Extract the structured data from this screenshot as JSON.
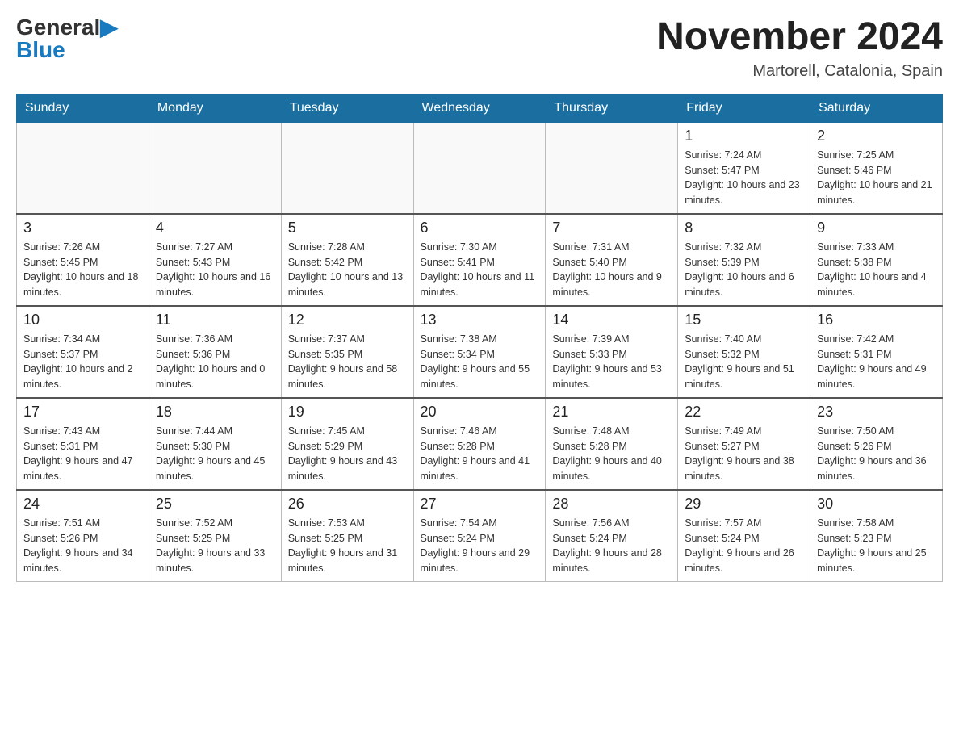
{
  "header": {
    "logo_general": "General",
    "logo_blue": "Blue",
    "month_year": "November 2024",
    "location": "Martorell, Catalonia, Spain"
  },
  "days_of_week": [
    "Sunday",
    "Monday",
    "Tuesday",
    "Wednesday",
    "Thursday",
    "Friday",
    "Saturday"
  ],
  "weeks": [
    [
      {
        "day": "",
        "info": ""
      },
      {
        "day": "",
        "info": ""
      },
      {
        "day": "",
        "info": ""
      },
      {
        "day": "",
        "info": ""
      },
      {
        "day": "",
        "info": ""
      },
      {
        "day": "1",
        "info": "Sunrise: 7:24 AM\nSunset: 5:47 PM\nDaylight: 10 hours and 23 minutes."
      },
      {
        "day": "2",
        "info": "Sunrise: 7:25 AM\nSunset: 5:46 PM\nDaylight: 10 hours and 21 minutes."
      }
    ],
    [
      {
        "day": "3",
        "info": "Sunrise: 7:26 AM\nSunset: 5:45 PM\nDaylight: 10 hours and 18 minutes."
      },
      {
        "day": "4",
        "info": "Sunrise: 7:27 AM\nSunset: 5:43 PM\nDaylight: 10 hours and 16 minutes."
      },
      {
        "day": "5",
        "info": "Sunrise: 7:28 AM\nSunset: 5:42 PM\nDaylight: 10 hours and 13 minutes."
      },
      {
        "day": "6",
        "info": "Sunrise: 7:30 AM\nSunset: 5:41 PM\nDaylight: 10 hours and 11 minutes."
      },
      {
        "day": "7",
        "info": "Sunrise: 7:31 AM\nSunset: 5:40 PM\nDaylight: 10 hours and 9 minutes."
      },
      {
        "day": "8",
        "info": "Sunrise: 7:32 AM\nSunset: 5:39 PM\nDaylight: 10 hours and 6 minutes."
      },
      {
        "day": "9",
        "info": "Sunrise: 7:33 AM\nSunset: 5:38 PM\nDaylight: 10 hours and 4 minutes."
      }
    ],
    [
      {
        "day": "10",
        "info": "Sunrise: 7:34 AM\nSunset: 5:37 PM\nDaylight: 10 hours and 2 minutes."
      },
      {
        "day": "11",
        "info": "Sunrise: 7:36 AM\nSunset: 5:36 PM\nDaylight: 10 hours and 0 minutes."
      },
      {
        "day": "12",
        "info": "Sunrise: 7:37 AM\nSunset: 5:35 PM\nDaylight: 9 hours and 58 minutes."
      },
      {
        "day": "13",
        "info": "Sunrise: 7:38 AM\nSunset: 5:34 PM\nDaylight: 9 hours and 55 minutes."
      },
      {
        "day": "14",
        "info": "Sunrise: 7:39 AM\nSunset: 5:33 PM\nDaylight: 9 hours and 53 minutes."
      },
      {
        "day": "15",
        "info": "Sunrise: 7:40 AM\nSunset: 5:32 PM\nDaylight: 9 hours and 51 minutes."
      },
      {
        "day": "16",
        "info": "Sunrise: 7:42 AM\nSunset: 5:31 PM\nDaylight: 9 hours and 49 minutes."
      }
    ],
    [
      {
        "day": "17",
        "info": "Sunrise: 7:43 AM\nSunset: 5:31 PM\nDaylight: 9 hours and 47 minutes."
      },
      {
        "day": "18",
        "info": "Sunrise: 7:44 AM\nSunset: 5:30 PM\nDaylight: 9 hours and 45 minutes."
      },
      {
        "day": "19",
        "info": "Sunrise: 7:45 AM\nSunset: 5:29 PM\nDaylight: 9 hours and 43 minutes."
      },
      {
        "day": "20",
        "info": "Sunrise: 7:46 AM\nSunset: 5:28 PM\nDaylight: 9 hours and 41 minutes."
      },
      {
        "day": "21",
        "info": "Sunrise: 7:48 AM\nSunset: 5:28 PM\nDaylight: 9 hours and 40 minutes."
      },
      {
        "day": "22",
        "info": "Sunrise: 7:49 AM\nSunset: 5:27 PM\nDaylight: 9 hours and 38 minutes."
      },
      {
        "day": "23",
        "info": "Sunrise: 7:50 AM\nSunset: 5:26 PM\nDaylight: 9 hours and 36 minutes."
      }
    ],
    [
      {
        "day": "24",
        "info": "Sunrise: 7:51 AM\nSunset: 5:26 PM\nDaylight: 9 hours and 34 minutes."
      },
      {
        "day": "25",
        "info": "Sunrise: 7:52 AM\nSunset: 5:25 PM\nDaylight: 9 hours and 33 minutes."
      },
      {
        "day": "26",
        "info": "Sunrise: 7:53 AM\nSunset: 5:25 PM\nDaylight: 9 hours and 31 minutes."
      },
      {
        "day": "27",
        "info": "Sunrise: 7:54 AM\nSunset: 5:24 PM\nDaylight: 9 hours and 29 minutes."
      },
      {
        "day": "28",
        "info": "Sunrise: 7:56 AM\nSunset: 5:24 PM\nDaylight: 9 hours and 28 minutes."
      },
      {
        "day": "29",
        "info": "Sunrise: 7:57 AM\nSunset: 5:24 PM\nDaylight: 9 hours and 26 minutes."
      },
      {
        "day": "30",
        "info": "Sunrise: 7:58 AM\nSunset: 5:23 PM\nDaylight: 9 hours and 25 minutes."
      }
    ]
  ]
}
